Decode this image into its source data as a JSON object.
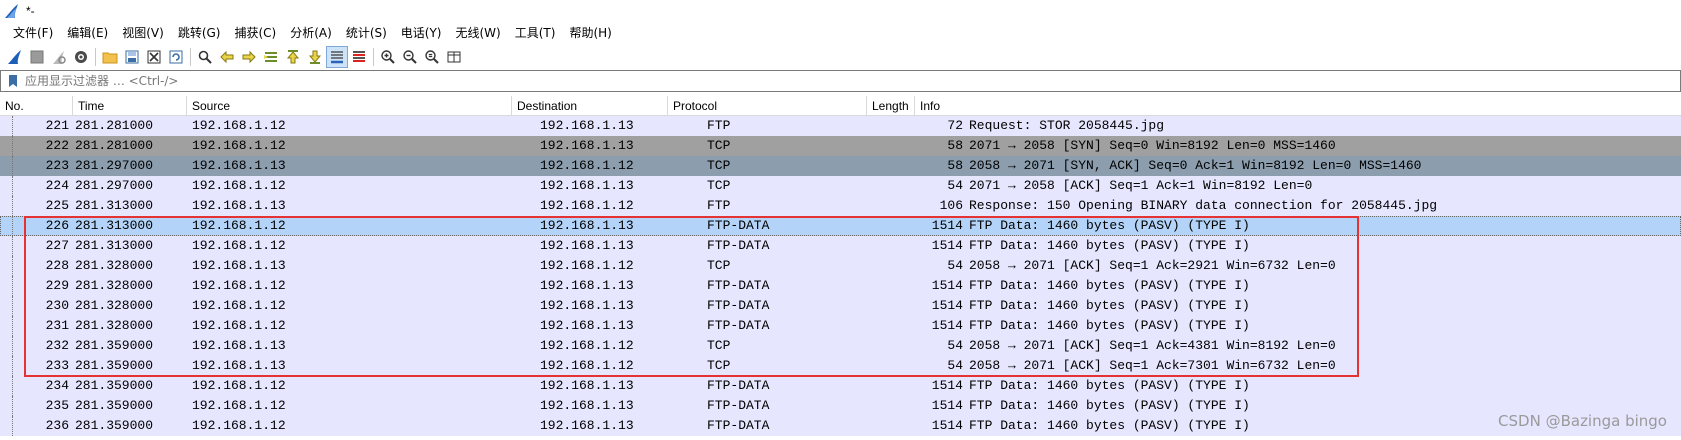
{
  "window": {
    "title": "*-"
  },
  "menu": [
    "文件(F)",
    "编辑(E)",
    "视图(V)",
    "跳转(G)",
    "捕获(C)",
    "分析(A)",
    "统计(S)",
    "电话(Y)",
    "无线(W)",
    "工具(T)",
    "帮助(H)"
  ],
  "toolbar": {
    "icons": [
      "shark-start-icon",
      "stop-icon",
      "restart-icon",
      "options-gear-icon",
      "open-folder-icon",
      "save-file-icon",
      "close-file-icon",
      "reload-icon",
      "find-icon",
      "back-arrow-icon",
      "forward-arrow-icon",
      "go-to-packet-icon",
      "first-packet-icon",
      "last-packet-icon",
      "autoscroll-icon",
      "colorize-icon",
      "zoom-in-icon",
      "zoom-out-icon",
      "zoom-normal-icon",
      "resize-columns-icon"
    ]
  },
  "filter": {
    "placeholder": "应用显示过滤器 … <Ctrl-/>",
    "value": ""
  },
  "table": {
    "columns": [
      "No.",
      "Time",
      "Source",
      "Destination",
      "Protocol",
      "Length",
      "Info"
    ],
    "rows": [
      {
        "no": "221",
        "time": "281.281000",
        "src": "192.168.1.12",
        "dst": "192.168.1.13",
        "proto": "FTP",
        "len": "72",
        "info": "Request: STOR 2058445.jpg",
        "style": "ftp"
      },
      {
        "no": "222",
        "time": "281.281000",
        "src": "192.168.1.12",
        "dst": "192.168.1.13",
        "proto": "TCP",
        "len": "58",
        "info": "2071 → 2058 [SYN] Seq=0 Win=8192 Len=0 MSS=1460",
        "style": "syn"
      },
      {
        "no": "223",
        "time": "281.297000",
        "src": "192.168.1.13",
        "dst": "192.168.1.12",
        "proto": "TCP",
        "len": "58",
        "info": "2058 → 2071 [SYN, ACK] Seq=0 Ack=1 Win=8192 Len=0 MSS=1460",
        "style": "tcp-dark"
      },
      {
        "no": "224",
        "time": "281.297000",
        "src": "192.168.1.12",
        "dst": "192.168.1.13",
        "proto": "TCP",
        "len": "54",
        "info": "2071 → 2058 [ACK] Seq=1 Ack=1 Win=8192 Len=0",
        "style": "ftp"
      },
      {
        "no": "225",
        "time": "281.313000",
        "src": "192.168.1.13",
        "dst": "192.168.1.12",
        "proto": "FTP",
        "len": "106",
        "info": "Response: 150 Opening BINARY data connection for 2058445.jpg",
        "style": "ftp"
      },
      {
        "no": "226",
        "time": "281.313000",
        "src": "192.168.1.12",
        "dst": "192.168.1.13",
        "proto": "FTP-DATA",
        "len": "1514",
        "info": "FTP Data: 1460 bytes (PASV) (TYPE I)",
        "style": "selected"
      },
      {
        "no": "227",
        "time": "281.313000",
        "src": "192.168.1.12",
        "dst": "192.168.1.13",
        "proto": "FTP-DATA",
        "len": "1514",
        "info": "FTP Data: 1460 bytes (PASV) (TYPE I)",
        "style": "ftp"
      },
      {
        "no": "228",
        "time": "281.328000",
        "src": "192.168.1.13",
        "dst": "192.168.1.12",
        "proto": "TCP",
        "len": "54",
        "info": "2058 → 2071 [ACK] Seq=1 Ack=2921 Win=6732 Len=0",
        "style": "ftp"
      },
      {
        "no": "229",
        "time": "281.328000",
        "src": "192.168.1.12",
        "dst": "192.168.1.13",
        "proto": "FTP-DATA",
        "len": "1514",
        "info": "FTP Data: 1460 bytes (PASV) (TYPE I)",
        "style": "ftp"
      },
      {
        "no": "230",
        "time": "281.328000",
        "src": "192.168.1.12",
        "dst": "192.168.1.13",
        "proto": "FTP-DATA",
        "len": "1514",
        "info": "FTP Data: 1460 bytes (PASV) (TYPE I)",
        "style": "ftp"
      },
      {
        "no": "231",
        "time": "281.328000",
        "src": "192.168.1.12",
        "dst": "192.168.1.13",
        "proto": "FTP-DATA",
        "len": "1514",
        "info": "FTP Data: 1460 bytes (PASV) (TYPE I)",
        "style": "ftp"
      },
      {
        "no": "232",
        "time": "281.359000",
        "src": "192.168.1.13",
        "dst": "192.168.1.12",
        "proto": "TCP",
        "len": "54",
        "info": "2058 → 2071 [ACK] Seq=1 Ack=4381 Win=8192 Len=0",
        "style": "ftp"
      },
      {
        "no": "233",
        "time": "281.359000",
        "src": "192.168.1.13",
        "dst": "192.168.1.12",
        "proto": "TCP",
        "len": "54",
        "info": "2058 → 2071 [ACK] Seq=1 Ack=7301 Win=6732 Len=0",
        "style": "ftp"
      },
      {
        "no": "234",
        "time": "281.359000",
        "src": "192.168.1.12",
        "dst": "192.168.1.13",
        "proto": "FTP-DATA",
        "len": "1514",
        "info": "FTP Data: 1460 bytes (PASV) (TYPE I)",
        "style": "ftp"
      },
      {
        "no": "235",
        "time": "281.359000",
        "src": "192.168.1.12",
        "dst": "192.168.1.13",
        "proto": "FTP-DATA",
        "len": "1514",
        "info": "FTP Data: 1460 bytes (PASV) (TYPE I)",
        "style": "ftp"
      },
      {
        "no": "236",
        "time": "281.359000",
        "src": "192.168.1.12",
        "dst": "192.168.1.13",
        "proto": "FTP-DATA",
        "len": "1514",
        "info": "FTP Data: 1460 bytes (PASV) (TYPE I)",
        "style": "ftp"
      }
    ]
  },
  "colors": {
    "ftp_row": "#e7e6ff",
    "syn_row": "#a0a0a0",
    "tcp_dark_row": "#8c9eae",
    "selected_row": "#b3d4f8",
    "highlight_box": "#e53333"
  },
  "watermark": "CSDN @Bazinga bingo"
}
